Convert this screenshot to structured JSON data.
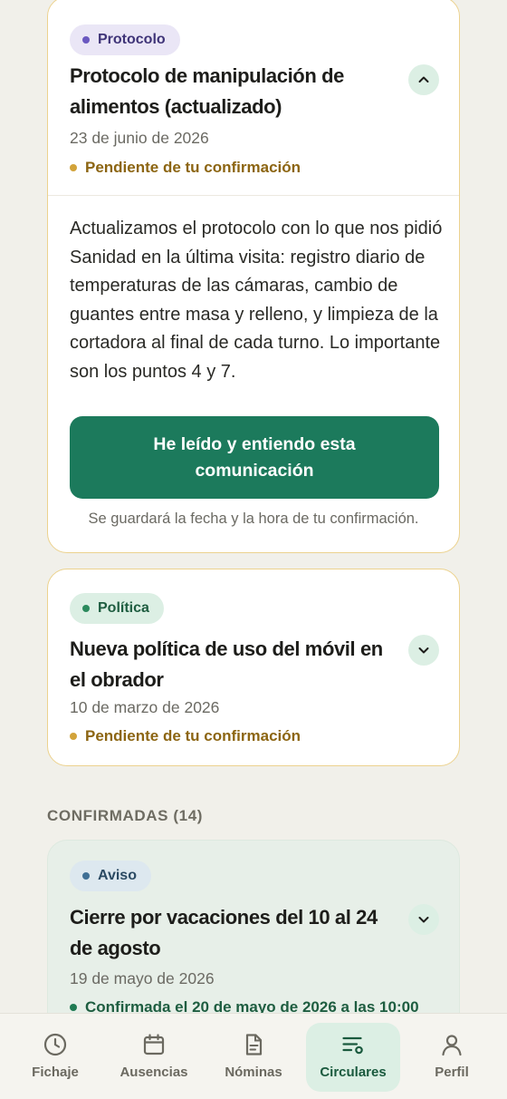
{
  "cards": [
    {
      "category": "Protocolo",
      "title": "Protocolo de manipulación de alimentos (actualizado)",
      "date": "23 de junio de 2026",
      "status": "Pendiente de tu confirmación",
      "body": "Actualizamos el protocolo con lo que nos pidió Sanidad en la última visita: registro diario de temperaturas de las cámaras, cambio de guantes entre masa y relleno, y limpieza de la cortadora al final de cada turno. Lo importante son los puntos 4 y 7.",
      "confirm_button": "He leído y entiendo esta comunicación",
      "confirm_note": "Se guardará la fecha y la hora de tu confirmación.",
      "expanded": true
    },
    {
      "category": "Política",
      "title": "Nueva política de uso del móvil en el obrador",
      "date": "10 de marzo de 2026",
      "status": "Pendiente de tu confirmación",
      "expanded": false
    }
  ],
  "confirmed_section": {
    "heading": "CONFIRMADAS (14)",
    "cards": [
      {
        "category": "Aviso",
        "title": "Cierre por vacaciones del 10 al 24 de agosto",
        "date": "19 de mayo de 2026",
        "status": "Confirmada el 20 de mayo de 2026 a las 10:00"
      }
    ]
  },
  "tabbar": {
    "active": "Circulares",
    "tabs": [
      {
        "label": "Fichaje",
        "icon": "clock-icon"
      },
      {
        "label": "Ausencias",
        "icon": "calendar-icon"
      },
      {
        "label": "Nóminas",
        "icon": "document-icon"
      },
      {
        "label": "Circulares",
        "icon": "circulars-icon"
      },
      {
        "label": "Perfil",
        "icon": "user-icon"
      }
    ]
  },
  "colors": {
    "accent": "#1c7a5c",
    "pending": "#8c6512",
    "background": "#f1f0ea"
  }
}
